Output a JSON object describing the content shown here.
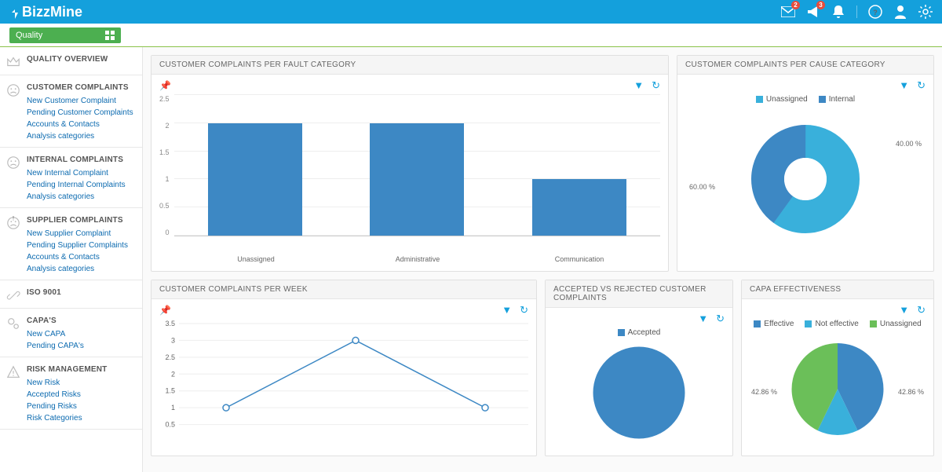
{
  "brand": "BizzMine",
  "topbar": {
    "mail_badge": "2",
    "announce_badge": "3"
  },
  "module": {
    "name": "Quality"
  },
  "sidebar": [
    {
      "id": "overview",
      "title": "QUALITY OVERVIEW",
      "icon": "crown",
      "links": []
    },
    {
      "id": "cust",
      "title": "CUSTOMER COMPLAINTS",
      "icon": "sad",
      "links": [
        "New Customer Complaint",
        "Pending Customer Complaints",
        "Accounts & Contacts",
        "Analysis categories"
      ]
    },
    {
      "id": "internal",
      "title": "INTERNAL COMPLAINTS",
      "icon": "sad",
      "links": [
        "New Internal Complaint",
        "Pending Internal Complaints",
        "Analysis categories"
      ]
    },
    {
      "id": "supplier",
      "title": "SUPPLIER COMPLAINTS",
      "icon": "sad-alert",
      "links": [
        "New Supplier Complaint",
        "Pending Supplier Complaints",
        "Accounts & Contacts",
        "Analysis categories"
      ]
    },
    {
      "id": "iso",
      "title": "ISO 9001",
      "icon": "link",
      "links": []
    },
    {
      "id": "capa",
      "title": "CAPA'S",
      "icon": "gears",
      "links": [
        "New CAPA",
        "Pending CAPA's"
      ]
    },
    {
      "id": "risk",
      "title": "RISK MANAGEMENT",
      "icon": "warn",
      "links": [
        "New Risk",
        "Accepted Risks",
        "Pending Risks",
        "Risk Categories"
      ]
    }
  ],
  "panels": {
    "fault": {
      "title": "CUSTOMER COMPLAINTS PER FAULT CATEGORY"
    },
    "cause": {
      "title": "CUSTOMER COMPLAINTS PER CAUSE CATEGORY"
    },
    "week": {
      "title": "CUSTOMER COMPLAINTS PER WEEK"
    },
    "accrej": {
      "title": "ACCEPTED VS REJECTED CUSTOMER COMPLAINTS"
    },
    "capaeff": {
      "title": "CAPA EFFECTIVENESS"
    }
  },
  "chart_data": [
    {
      "id": "fault",
      "type": "bar",
      "categories": [
        "Unassigned",
        "Administrative",
        "Communication"
      ],
      "values": [
        2,
        2,
        1
      ],
      "ylim": [
        0,
        2.5
      ],
      "yticks": [
        0,
        0.5,
        1,
        1.5,
        2,
        2.5
      ]
    },
    {
      "id": "cause",
      "type": "donut",
      "series": [
        {
          "name": "Unassigned",
          "value": 60.0,
          "color": "#39b0db"
        },
        {
          "name": "Internal",
          "value": 40.0,
          "color": "#3d88c4"
        }
      ],
      "labels": [
        "60.00 %",
        "40.00 %"
      ]
    },
    {
      "id": "week",
      "type": "line",
      "x": [
        1,
        2,
        3
      ],
      "values": [
        1,
        3,
        1
      ],
      "ylim": [
        0,
        3.5
      ],
      "yticks": [
        0.5,
        1,
        1.5,
        2,
        2.5,
        3,
        3.5
      ]
    },
    {
      "id": "accrej",
      "type": "pie",
      "series": [
        {
          "name": "Accepted",
          "value": 100,
          "color": "#3d88c4"
        }
      ]
    },
    {
      "id": "capaeff",
      "type": "pie",
      "series": [
        {
          "name": "Effective",
          "value": 42.86,
          "color": "#3d88c4"
        },
        {
          "name": "Not effective",
          "value": 14.28,
          "color": "#39b0db"
        },
        {
          "name": "Unassigned",
          "value": 42.86,
          "color": "#6bbf59"
        }
      ],
      "labels": [
        "42.86 %",
        "42.86 %"
      ]
    }
  ]
}
